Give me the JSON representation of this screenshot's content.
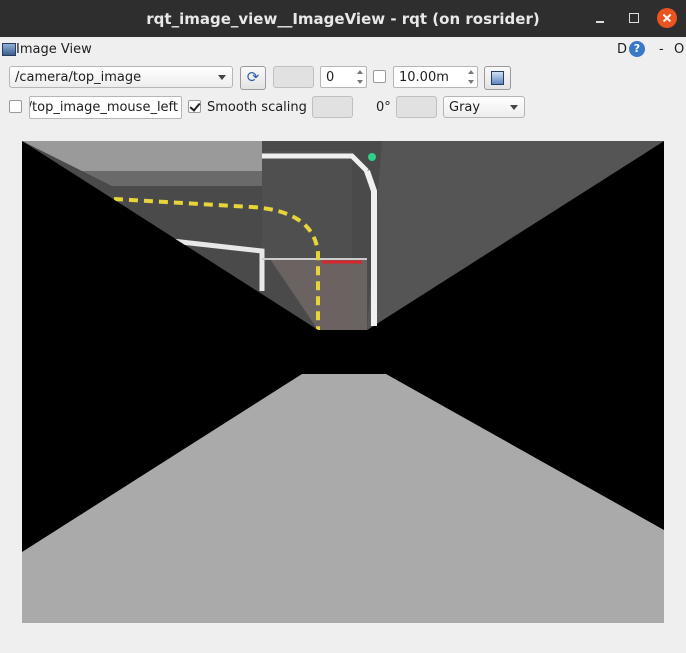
{
  "window": {
    "title": "rqt_image_view__ImageView - rqt (on rosrider)"
  },
  "dock": {
    "title": "Image View",
    "d_label": "D",
    "help_label": "?",
    "dash_label": "-",
    "o_label": "O"
  },
  "toolbar": {
    "topic": "/camera/top_image",
    "zoom_value": "0",
    "max_range": "10.00m",
    "refresh_icon": "refresh-icon",
    "save_icon": "save-icon"
  },
  "row2": {
    "mouse_topic": "/camera/top_image_mouse_left",
    "smooth_label": "Smooth scaling",
    "smooth_checked": true,
    "rotation_label": "0°",
    "colormap": "Gray"
  },
  "image": {
    "content": "warped top-down camera view of track"
  },
  "colors": {
    "titlebar": "#2e2e2e",
    "close_button": "#e95420",
    "panel": "#efefef",
    "image_bg": "#000000",
    "gray_floor": "#aaaaaa"
  }
}
